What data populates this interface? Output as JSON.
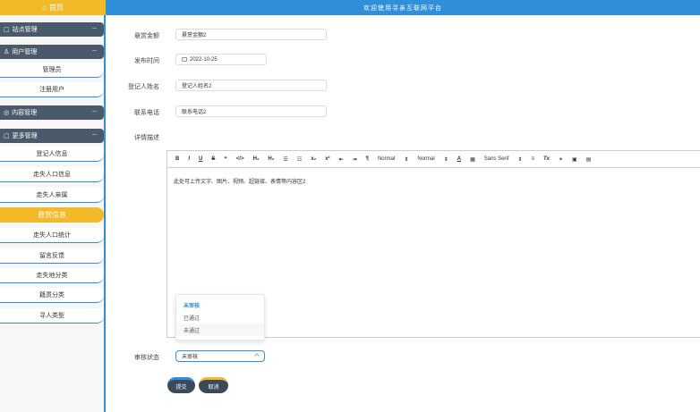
{
  "header": {
    "home_label": "首页",
    "home_icon": "home-icon",
    "title": "欢迎使用寻亲互联网平台"
  },
  "sidebar": {
    "groups": [
      {
        "label": "站点管理"
      },
      {
        "label": "用户管理",
        "items": [
          "管理员",
          "注册用户"
        ]
      },
      {
        "label": "内容管理"
      },
      {
        "label": "更多管理",
        "items": [
          "登记人信息",
          "走失人口信息",
          "走失人亲属",
          "悬赏信息",
          "走失人口统计",
          "留言反馈",
          "走失地分类",
          "籍贯分类",
          "寻人类型"
        ]
      }
    ],
    "active_item": "悬赏信息"
  },
  "form": {
    "reward": {
      "label": "悬赏金额",
      "value": "悬赏金额2"
    },
    "publish_time": {
      "label": "发布时间",
      "value": "2022-10-25"
    },
    "registrant_name": {
      "label": "登记人姓名",
      "value": "登记人姓名2"
    },
    "phone": {
      "label": "联系电话",
      "value": "联系电话2"
    },
    "details": {
      "label": "详情描述",
      "content": "此处可上传文字、图片、视频、超链接、表情等内容区2",
      "toolbar": [
        "B",
        "I",
        "U",
        "S",
        "❞",
        "</>",
        "H₁",
        "H₂",
        "☰",
        "☷",
        "x₂",
        "x²",
        "⇤",
        "⇥",
        "¶",
        "Normal",
        "⇕",
        "Normal",
        "⇕",
        "A",
        "▦",
        "Sans Serif",
        "⇕",
        "≡",
        "Tx",
        "⚭",
        "▣",
        "▤"
      ]
    },
    "status": {
      "label": "审核状态",
      "value": "未审核",
      "options": [
        "未审核",
        "已通过",
        "未通过"
      ]
    }
  },
  "buttons": {
    "submit": "提交",
    "cancel": "取消"
  },
  "colors": {
    "primary": "#2f8fd8",
    "accent": "#f2b928",
    "menu_dark": "#4b5a6b",
    "button_dark": "#3a4a5c"
  }
}
